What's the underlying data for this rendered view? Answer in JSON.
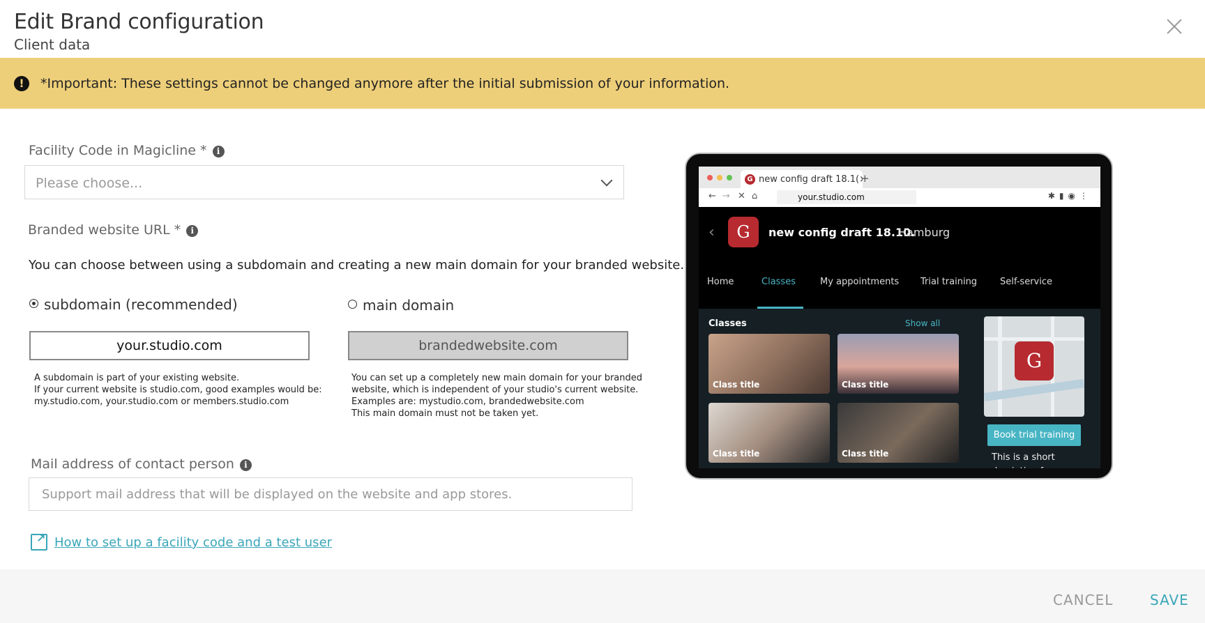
{
  "header": {
    "title": "Edit Brand configuration",
    "subtitle": "Client data"
  },
  "banner": {
    "text": "*Important: These settings cannot be changed anymore after the initial submission of your information.",
    "color": "#eecf79"
  },
  "facility": {
    "label": "Facility Code in Magicline *",
    "placeholder": "Please choose..."
  },
  "website": {
    "label": "Branded website URL *",
    "description": "You can choose between using a subdomain and creating a new main domain for your branded website.",
    "options": [
      {
        "label": "subdomain (recommended)",
        "checked": true,
        "value": "your.studio.com",
        "note": [
          "A subdomain is part of your existing website.",
          "If your current website is studio.com, good examples would be:",
          "my.studio.com, your.studio.com or members.studio.com"
        ]
      },
      {
        "label": "main domain",
        "checked": false,
        "value": "brandedwebsite.com",
        "note": [
          "You can set up a completely new main domain for your branded",
          "website, which is independent of your studio's current website.",
          "Examples are: mystudio.com, brandedwebsite.com",
          "This main domain must not be taken yet."
        ]
      }
    ]
  },
  "mail": {
    "label": "Mail address of contact person",
    "placeholder": "Support mail address that will be displayed on the website and app stores."
  },
  "help_link": {
    "text": "How to set up a facility code and a test user"
  },
  "footer": {
    "cancel_label": "CANCEL",
    "save_label": "SAVE",
    "accent_color": "#3aa6b9"
  },
  "preview": {
    "browser_tab": "new config draft 18.1(×",
    "tab_plus": "+",
    "address": "your.studio.com",
    "logo_letter": "G",
    "site_name": "new config draft 18.10.",
    "site_city": "Hamburg",
    "nav": [
      "Home",
      "Classes",
      "My appointments",
      "Trial training",
      "Self-service"
    ],
    "nav_active": "Classes",
    "section_title": "Classes",
    "show_all": "Show all",
    "cards": [
      "Class title",
      "Class title",
      "Class title",
      "Class title"
    ],
    "trial_button": "Book trial training",
    "short_description": "This is a short decription for your",
    "brand_color": "#b62a30",
    "accent_color": "#48b5c4"
  }
}
